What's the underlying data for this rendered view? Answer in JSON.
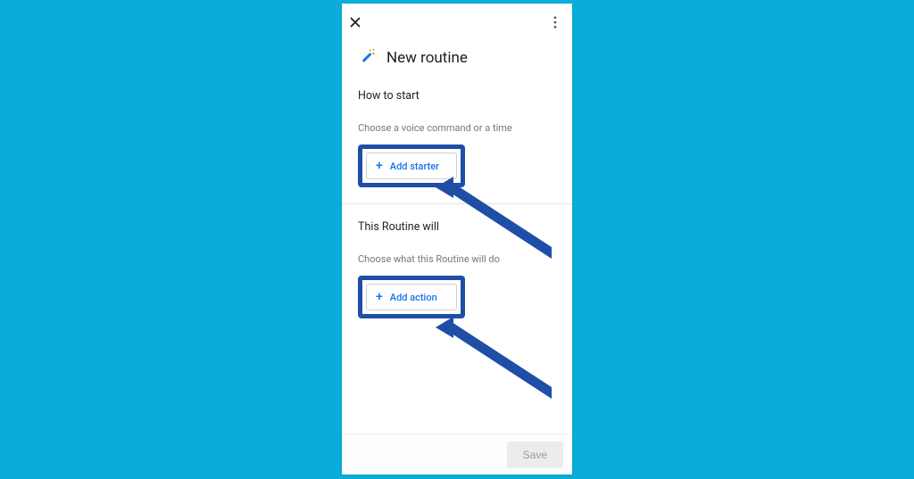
{
  "header": {
    "close_icon": "close-icon",
    "more_icon": "more-vertical-icon"
  },
  "title": {
    "icon": "magic-wand-icon",
    "label": "New routine"
  },
  "start_section": {
    "heading": "How to start",
    "hint": "Choose a voice command or a time",
    "button_label": "Add starter"
  },
  "will_section": {
    "heading": "This Routine will",
    "hint": "Choose what this Routine will do",
    "button_label": "Add action"
  },
  "footer": {
    "save_label": "Save"
  },
  "annotation": {
    "arrow_color": "#1f4ea7"
  }
}
